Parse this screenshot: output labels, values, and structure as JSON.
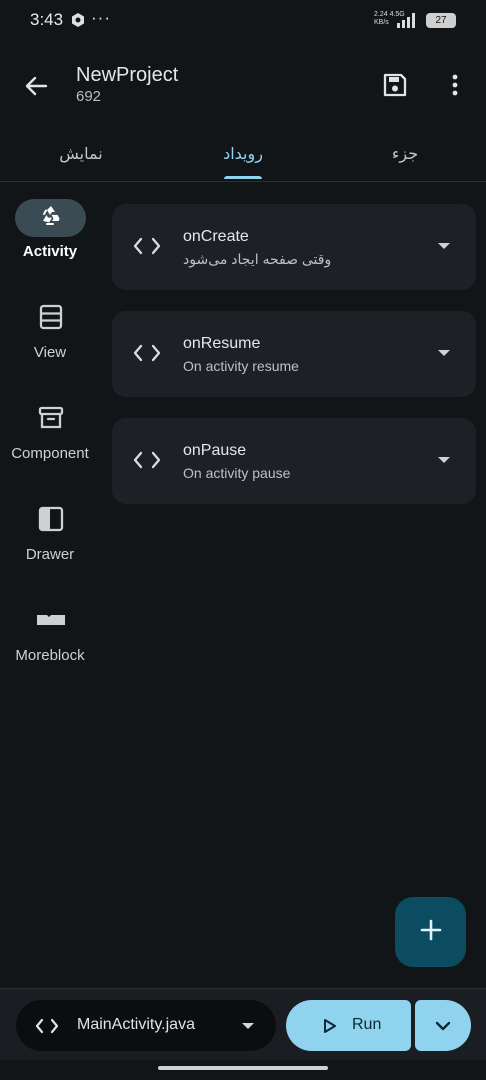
{
  "status_bar": {
    "time": "3:43",
    "speed_value": "2.24",
    "speed_unit": "KB/s",
    "network": "4.5G",
    "battery": "27"
  },
  "app_bar": {
    "title": "NewProject",
    "subtitle": "692"
  },
  "tabs": [
    {
      "label": "نمایش",
      "active": false
    },
    {
      "label": "رویداد",
      "active": true
    },
    {
      "label": "جزء",
      "active": false
    }
  ],
  "nav_rail": [
    {
      "label": "Activity",
      "icon": "recycle-icon",
      "active": true
    },
    {
      "label": "View",
      "icon": "view-list-icon",
      "active": false
    },
    {
      "label": "Component",
      "icon": "archive-icon",
      "active": false
    },
    {
      "label": "Drawer",
      "icon": "drawer-icon",
      "active": false
    },
    {
      "label": "Moreblock",
      "icon": "moreblock-icon",
      "active": false
    }
  ],
  "events": [
    {
      "title": "onCreate",
      "description": "وقتی صفحه ایجاد می‌شود"
    },
    {
      "title": "onResume",
      "description": "On activity resume"
    },
    {
      "title": "onPause",
      "description": "On activity pause"
    }
  ],
  "bottom_bar": {
    "file_name": "MainActivity.java",
    "run_label": "Run"
  },
  "colors": {
    "background": "#121518",
    "card": "#1d2125",
    "accent": "#8fd3ee",
    "fab": "#0c4c60",
    "rail_active": "#3b4b54"
  }
}
